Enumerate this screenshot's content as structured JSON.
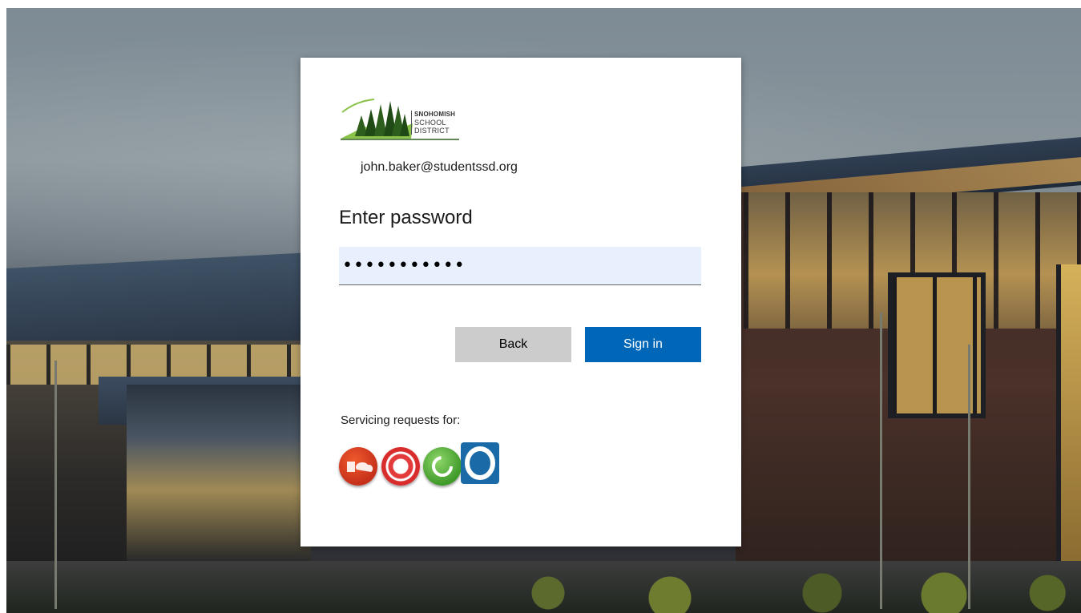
{
  "background": {
    "description_icon": "school-building-photo"
  },
  "logo": {
    "line1": "SNOHOMISH",
    "line2": "SCHOOL",
    "line3": "DISTRICT",
    "icon": "pine-trees-logo"
  },
  "identity": {
    "email": "john.baker@studentssd.org"
  },
  "heading": "Enter password",
  "password": {
    "value": "•••••••••••"
  },
  "buttons": {
    "back": "Back",
    "sign_in": "Sign in"
  },
  "servicing": {
    "label": "Servicing requests for:",
    "apps": [
      {
        "icon": "office-365-icon"
      },
      {
        "icon": "canvas-icon"
      },
      {
        "icon": "green-circle-app-icon"
      },
      {
        "icon": "overdrive-icon"
      }
    ]
  },
  "colors": {
    "primary_button": "#0067b8",
    "secondary_button": "#cccccc",
    "input_background": "#e8f0fe"
  }
}
